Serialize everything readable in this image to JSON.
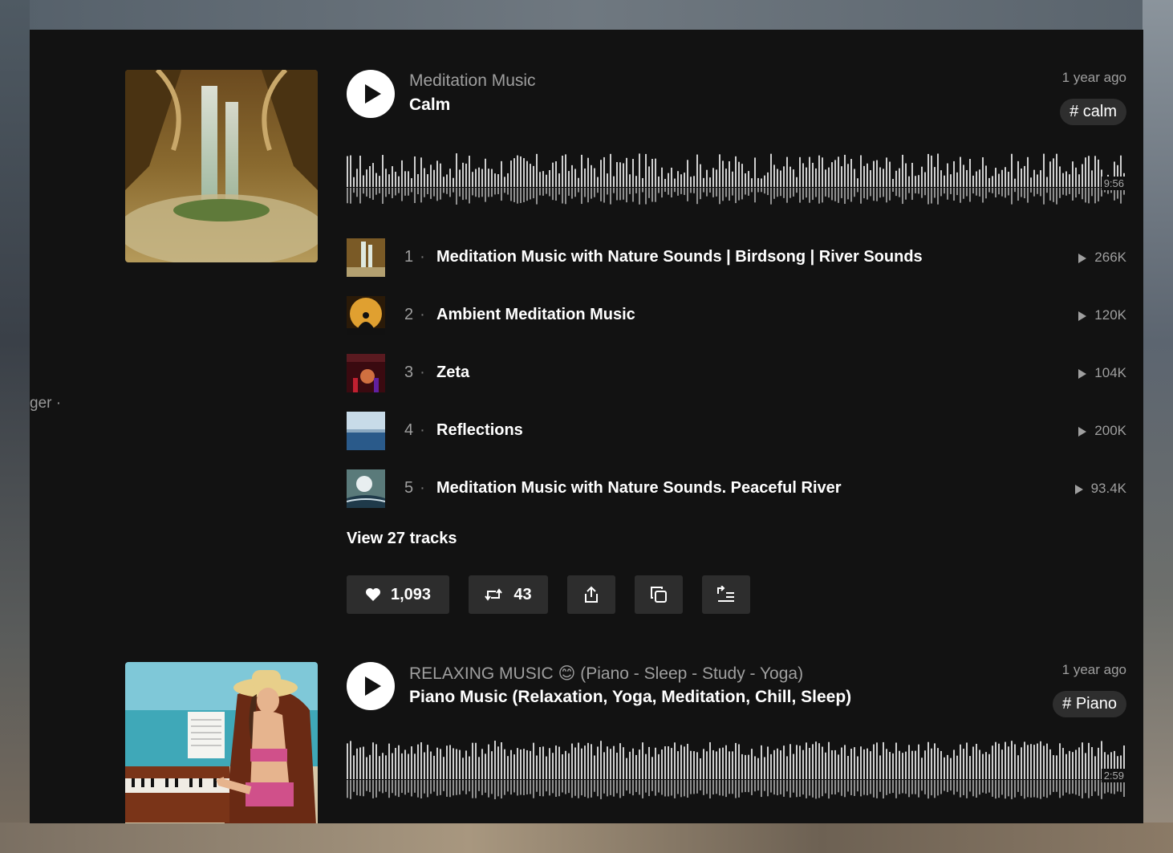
{
  "side_fragment": "ger ·",
  "playlists": [
    {
      "artist": "Meditation Music",
      "title": "Calm",
      "posted": "1 year ago",
      "tag": "# calm",
      "duration": "9:56",
      "tracks": [
        {
          "num": "1",
          "title": "Meditation Music with Nature Sounds | Birdsong | River Sounds",
          "plays": "266K"
        },
        {
          "num": "2",
          "title": "Ambient Meditation Music",
          "plays": "120K"
        },
        {
          "num": "3",
          "title": "Zeta",
          "plays": "104K"
        },
        {
          "num": "4",
          "title": "Reflections",
          "plays": "200K"
        },
        {
          "num": "5",
          "title": "Meditation Music with Nature Sounds. Peaceful River",
          "plays": "93.4K"
        }
      ],
      "view_all": "View 27 tracks",
      "likes": "1,093",
      "reposts": "43"
    },
    {
      "artist": "RELAXING MUSIC 😊 (Piano - Sleep - Study - Yoga)",
      "title": "Piano Music (Relaxation, Yoga, Meditation, Chill, Sleep)",
      "posted": "1 year ago",
      "tag": "# Piano",
      "duration": "2:59"
    }
  ]
}
